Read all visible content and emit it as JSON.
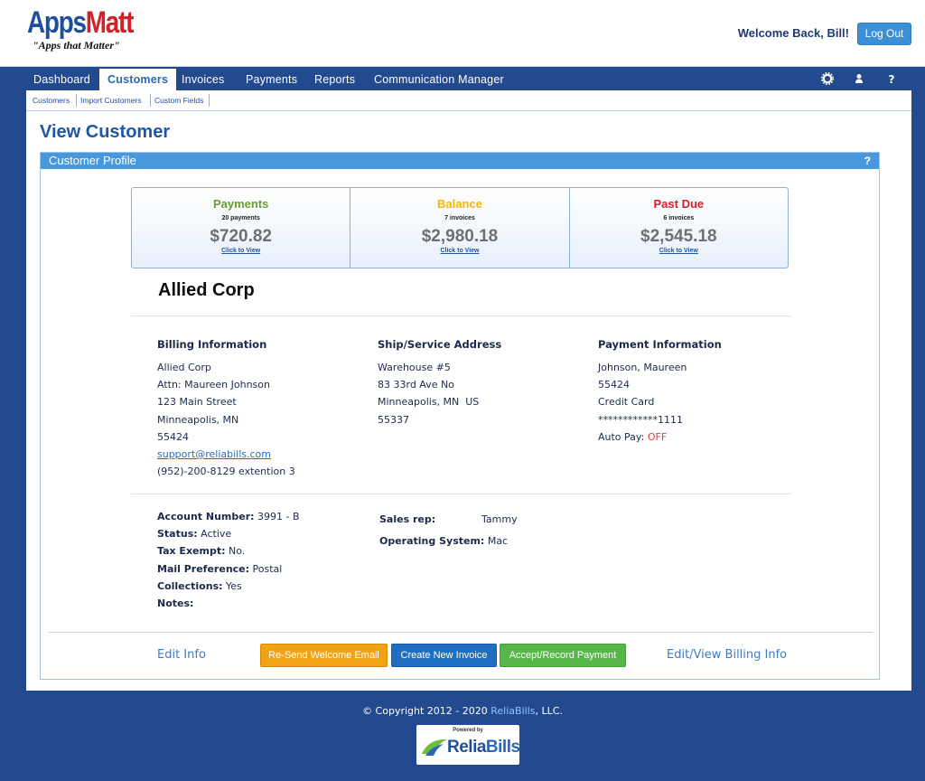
{
  "header": {
    "logo_apps": "Apps",
    "logo_matt": "Matt",
    "tagline": "\"Apps that Matter\"",
    "welcome": "Welcome Back, Bill!",
    "logout": "Log Out"
  },
  "nav": {
    "items": [
      "Dashboard",
      "Customers",
      "Invoices",
      "Payments",
      "Reports",
      "Communication Manager"
    ],
    "active": "Customers",
    "icons": [
      "gear-icon",
      "user-icon",
      "help-icon"
    ]
  },
  "subnav": {
    "items": [
      "Customers",
      "Import Customers",
      "Custom Fields"
    ]
  },
  "page_title": "View Customer",
  "profile": {
    "header": "Customer Profile",
    "help": "?",
    "stats": [
      {
        "title": "Payments",
        "sub": "20 payments",
        "amount": "$720.82",
        "link": "Click to View",
        "color": "#6a9d2e"
      },
      {
        "title": "Balance",
        "sub": "7 invoices",
        "amount": "$2,980.18",
        "link": "Click to View",
        "color": "#f2b705"
      },
      {
        "title": "Past Due",
        "sub": "6 invoices",
        "amount": "$2,545.18",
        "link": "Click to View",
        "color": "#d41f26"
      }
    ],
    "company": "Allied Corp",
    "billing": {
      "heading": "Billing Information",
      "name": "Allied Corp",
      "attn": "Attn: Maureen Johnson",
      "street": "123 Main Street",
      "city": "Minneapolis, MN",
      "zip": "55424",
      "email": "support@reliabills.com",
      "phone": "(952)-200-8129 extention 3"
    },
    "shipping": {
      "heading": "Ship/Service Address",
      "line1": "Warehouse #5",
      "line2": "83 33rd Ave No",
      "city": "Minneapolis, MN  US",
      "zip": "55337"
    },
    "payment": {
      "heading": "Payment Information",
      "name": "Johnson, Maureen",
      "zip": "55424",
      "method": "Credit Card",
      "masked": "************1111",
      "autopay_label": "Auto Pay:",
      "autopay_value": "OFF"
    },
    "details": {
      "account_label": "Account Number:",
      "account_value": "3991 - B",
      "status_label": "Status:",
      "status_value": "Active",
      "tax_label": "Tax Exempt:",
      "tax_value": "No.",
      "mail_label": "Mail Preference:",
      "mail_value": "Postal",
      "collections_label": "Collections:",
      "collections_value": "Yes",
      "notes_label": "Notes:",
      "salesrep_label": "Sales rep:",
      "salesrep_value": "Tammy",
      "os_label": "Operating System:",
      "os_value": "Mac"
    },
    "actions": {
      "edit_info": "Edit Info",
      "resend": "Re-Send Welcome Email",
      "new_invoice": "Create New Invoice",
      "record_payment": "Accept/Record Payment",
      "billing_info": "Edit/View Billing Info"
    }
  },
  "footer": {
    "prefix": "© Copyright 2012 - 2020 ",
    "brand": "ReliaBills",
    "suffix": ", LLC.",
    "powered": "Powered by",
    "logo_relia": "Relia",
    "logo_bills": "Bills"
  },
  "colors": {
    "nav_bg": "#23498f",
    "accent": "#4a98dc",
    "title_blue": "#1f56a6"
  }
}
